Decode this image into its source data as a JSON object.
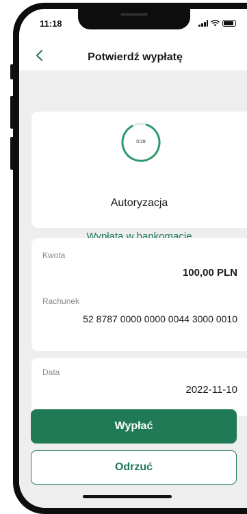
{
  "status_bar": {
    "time": "11:18"
  },
  "header": {
    "title": "Potwierdź wypłatę"
  },
  "authorization": {
    "timer": "0:28",
    "title": "Autoryzacja",
    "subtitle": "Wypłata w bankomacie"
  },
  "details": {
    "amount_label": "Kwota",
    "amount_value": "100,00 PLN",
    "account_label": "Rachunek",
    "account_value": "52 8787 0000 0000 0044 3000 0010",
    "date_label": "Data",
    "date_value": "2022-11-10"
  },
  "actions": {
    "confirm_label": "Wypłać",
    "reject_label": "Odrzuć"
  },
  "colors": {
    "accent": "#1f7a55",
    "background": "#eeeeee"
  }
}
